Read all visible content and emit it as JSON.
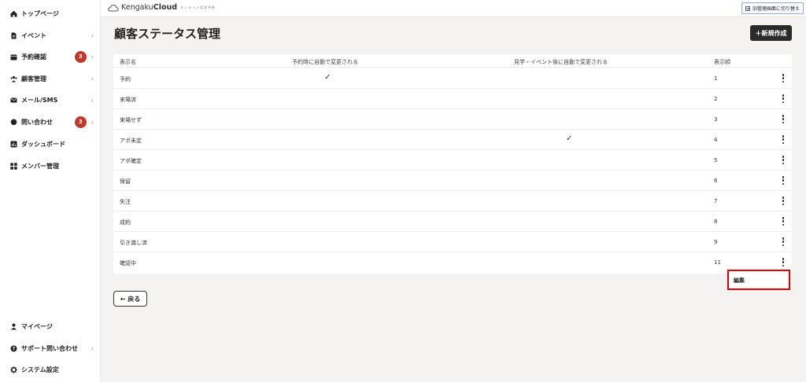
{
  "sidebar": {
    "items": [
      {
        "label": "トップページ",
        "icon": "home-icon",
        "chevron": ""
      },
      {
        "label": "イベント",
        "icon": "document-icon",
        "chevron": "›"
      },
      {
        "label": "予約確認",
        "icon": "calendar-icon",
        "chevron": "›",
        "badge": "3"
      },
      {
        "label": "顧客管理",
        "icon": "users-icon",
        "chevron": "›"
      },
      {
        "label": "メール/SMS",
        "icon": "mail-icon",
        "chevron": "›"
      },
      {
        "label": "問い合わせ",
        "icon": "chat-icon",
        "chevron": "›",
        "badge": "3"
      },
      {
        "label": "ダッシュボード",
        "icon": "chart-icon",
        "chevron": ""
      },
      {
        "label": "メンバー管理",
        "icon": "grid-icon",
        "chevron": ""
      }
    ],
    "bottom_items": [
      {
        "label": "マイページ",
        "icon": "person-icon",
        "chevron": ""
      },
      {
        "label": "サポート問い合わせ",
        "icon": "help-icon",
        "chevron": "›"
      },
      {
        "label": "システム設定",
        "icon": "gear-icon",
        "chevron": ""
      }
    ]
  },
  "header": {
    "logo_prefix": "Kengaku",
    "logo_bold": "Cloud",
    "logo_sub": "オンライン見学予約",
    "switch_label": "旧管理画面に切り替え"
  },
  "page": {
    "title": "顧客ステータス管理",
    "new_button": "＋新規作成",
    "back_button": "← 戻る"
  },
  "table": {
    "columns": [
      "表示名",
      "予約時に自動で変更される",
      "見学・イベント後に自動で変更される",
      "表示順"
    ],
    "rows": [
      {
        "name": "予約",
        "auto_on_reserve": "✓",
        "auto_after_event": "",
        "order": "1"
      },
      {
        "name": "来場済",
        "auto_on_reserve": "",
        "auto_after_event": "",
        "order": "2"
      },
      {
        "name": "来場せず",
        "auto_on_reserve": "",
        "auto_after_event": "",
        "order": "3"
      },
      {
        "name": "アポ未定",
        "auto_on_reserve": "",
        "auto_after_event": "✓",
        "order": "4"
      },
      {
        "name": "アポ確定",
        "auto_on_reserve": "",
        "auto_after_event": "",
        "order": "5"
      },
      {
        "name": "保留",
        "auto_on_reserve": "",
        "auto_after_event": "",
        "order": "6"
      },
      {
        "name": "失注",
        "auto_on_reserve": "",
        "auto_after_event": "",
        "order": "7"
      },
      {
        "name": "成約",
        "auto_on_reserve": "",
        "auto_after_event": "",
        "order": "8"
      },
      {
        "name": "引き渡し済",
        "auto_on_reserve": "",
        "auto_after_event": "",
        "order": "9"
      },
      {
        "name": "確認中",
        "auto_on_reserve": "",
        "auto_after_event": "",
        "order": "11"
      }
    ]
  },
  "dropdown": {
    "edit_label": "編集"
  },
  "colors": {
    "badge": "#c0392b",
    "primary_button": "#2a2a2a",
    "highlight": "#e00000",
    "background": "#f4f3f1"
  }
}
